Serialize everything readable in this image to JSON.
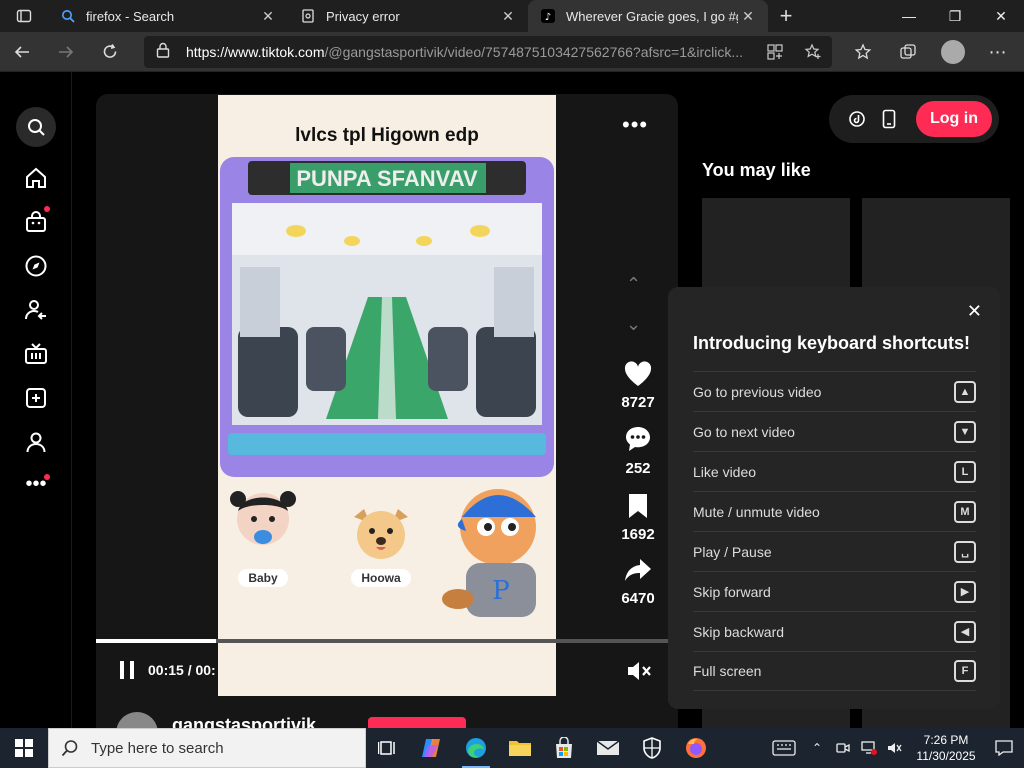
{
  "browser": {
    "tabs": [
      {
        "title": "firefox - Search",
        "active": false
      },
      {
        "title": "Privacy error",
        "active": false
      },
      {
        "title": "Wherever Gracie goes, I go #ger",
        "active": true
      }
    ],
    "url_host": "https://www.tiktok.com",
    "url_path": "/@gangstasportivik/video/7574875103427562766?afsrc=1&irclick..."
  },
  "video": {
    "caption": "lvlcs tpl Higown edp",
    "bus_sign": "PUNPA SFANVAV",
    "characters": [
      {
        "label": "Baby"
      },
      {
        "label": "Hoowa"
      }
    ],
    "progress_fraction": 0.21,
    "time_text": "00:15 / 00:"
  },
  "actions": {
    "likes": "8727",
    "comments": "252",
    "saves": "1692",
    "shares": "6470"
  },
  "creator": {
    "name": "gangstasportivik"
  },
  "header": {
    "login_label": "Log in"
  },
  "sidebar": {
    "you_may_like": "You may like"
  },
  "shortcuts": {
    "title": "Introducing keyboard shortcuts!",
    "items": [
      {
        "label": "Go to previous video",
        "key": "▲"
      },
      {
        "label": "Go to next video",
        "key": "▼"
      },
      {
        "label": "Like video",
        "key": "L"
      },
      {
        "label": "Mute / unmute video",
        "key": "M"
      },
      {
        "label": "Play / Pause",
        "key": "␣"
      },
      {
        "label": "Skip forward",
        "key": "▶"
      },
      {
        "label": "Skip backward",
        "key": "◀"
      },
      {
        "label": "Full screen",
        "key": "F"
      }
    ]
  },
  "taskbar": {
    "search_placeholder": "Type here to search",
    "time": "7:26 PM",
    "date": "11/30/2025"
  },
  "colors": {
    "accent": "#fe2c55",
    "background": "#000000",
    "panel": "#252525"
  }
}
